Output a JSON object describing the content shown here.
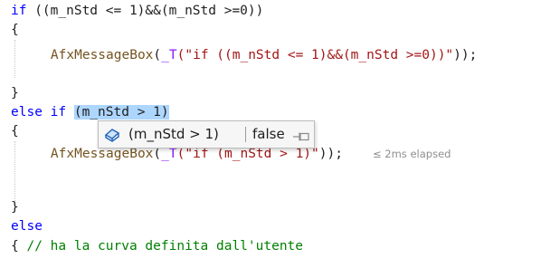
{
  "code": {
    "line1": {
      "kw": "if",
      "rest": " ((m_nStd <= 1)&&(m_nStd >=0))"
    },
    "line2": {
      "text": "{"
    },
    "line3": {
      "indent": "    ",
      "fn": "AfxMessageBox",
      "open": "(",
      "mac": "_T",
      "str": "(\"if ((m_nStd <= 1)&&(m_nStd >=0))\"",
      "close": "));"
    },
    "line5": {
      "text": "}"
    },
    "line6": {
      "kw1": "else",
      "sp": " ",
      "kw2": "if",
      "sp2": " ",
      "selected": "(m_nStd > 1)"
    },
    "line7": {
      "text": "{"
    },
    "line8": {
      "indent": "    ",
      "fn": "AfxMessageBox",
      "open": "(",
      "mac": "_T",
      "str": "(\"if (m_nStd > 1)\"",
      "close": "));"
    },
    "line11": {
      "text": "}"
    },
    "line12": {
      "kw": "else"
    },
    "line13": {
      "brace": "{ ",
      "comment": "// ha la curva definita dall'utente"
    }
  },
  "perf_tip": "≤ 2ms elapsed",
  "datatip": {
    "expression": "(m_nStd > 1)",
    "value": "false",
    "icon": "watch-variable-icon",
    "pin_icon": "pin-icon"
  },
  "colors": {
    "keyword": "#0000ff",
    "function": "#74531f",
    "string": "#a31515",
    "macro": "#8a1bff",
    "comment": "#008000",
    "selection": "#add6ff"
  }
}
